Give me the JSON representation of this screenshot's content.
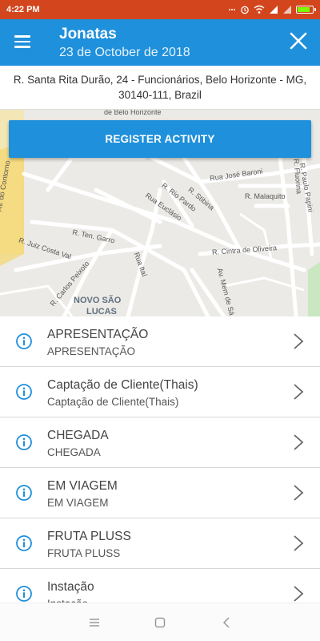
{
  "status_bar": {
    "time": "4:22 PM",
    "icons": [
      "more-icon",
      "alarm-icon",
      "wifi-icon",
      "signal-icon",
      "signal-icon",
      "battery-icon"
    ]
  },
  "header": {
    "title": "Jonatas",
    "subtitle": "23 de October de 2018",
    "menu_icon": "menu-icon",
    "close_icon": "close-icon"
  },
  "address": "R. Santa Rita Durão, 24 - Funcionários, Belo Horizonte - MG, 30140-111, Brazil",
  "map": {
    "labels": [
      "de Belo Horizonte",
      "Rua José Baroni",
      "R. Malaquito",
      "R. Stibina",
      "R. Rio Pardo",
      "Rua Euclásio",
      "R. Ten. Garro",
      "R. Juiz Costa Val",
      "R. Carlos Peixoto",
      "Rua Itaí",
      "NOVO SÃO",
      "LUCAS",
      "R. Cintra de Oliveira",
      "Av. Mem de Sá",
      "R. Paulo Papini",
      "R. Fluorina",
      "Av. do Contorno"
    ]
  },
  "register_button": "REGISTER ACTIVITY",
  "activities": [
    {
      "title": "APRESENTAÇÃO",
      "subtitle": "APRESENTAÇÃO"
    },
    {
      "title": "Captação de Cliente(Thais)",
      "subtitle": "Captação de Cliente(Thais)"
    },
    {
      "title": "CHEGADA",
      "subtitle": "CHEGADA"
    },
    {
      "title": "EM VIAGEM",
      "subtitle": "EM VIAGEM"
    },
    {
      "title": "FRUTA PLUSS",
      "subtitle": "FRUTA PLUSS"
    },
    {
      "title": "Instação",
      "subtitle": "Instação"
    }
  ],
  "colors": {
    "status_bar": "#d2451d",
    "primary": "#1f90db",
    "text": "#444444"
  }
}
